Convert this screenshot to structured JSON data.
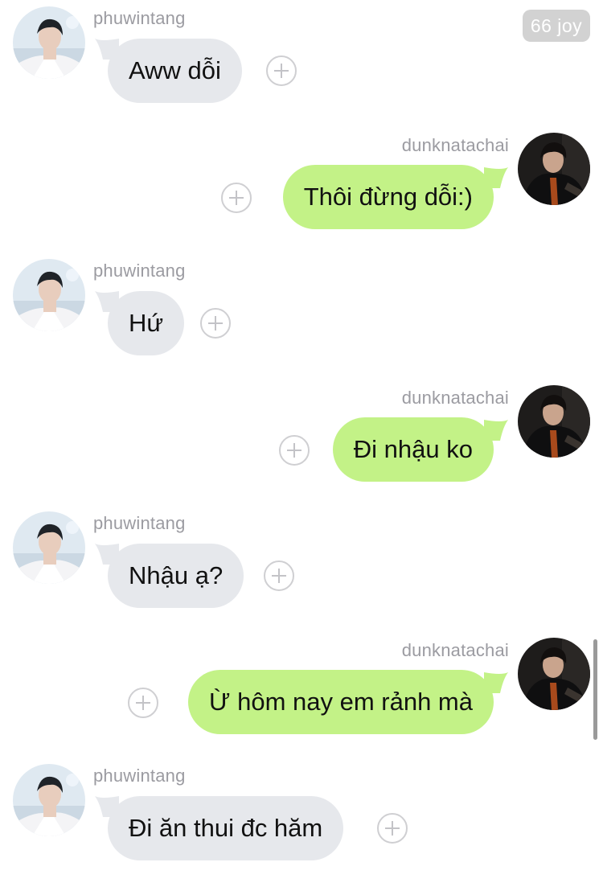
{
  "header": {
    "badge": "66 joy"
  },
  "messages": [
    {
      "sender": "phuwintang",
      "text": "Aww dỗi",
      "side": "incoming"
    },
    {
      "sender": "dunknatachai",
      "text": "Thôi đừng dỗi:)",
      "side": "outgoing"
    },
    {
      "sender": "phuwintang",
      "text": "Hứ",
      "side": "incoming"
    },
    {
      "sender": "dunknatachai",
      "text": "Đi nhậu ko",
      "side": "outgoing"
    },
    {
      "sender": "phuwintang",
      "text": "Nhậu ạ?",
      "side": "incoming"
    },
    {
      "sender": "dunknatachai",
      "text": "Ừ hôm nay em rảnh mà",
      "side": "outgoing"
    },
    {
      "sender": "phuwintang",
      "text": "Đi ăn thui đc hăm",
      "side": "incoming"
    }
  ],
  "colors": {
    "incoming_bubble": "#e6e8ec",
    "outgoing_bubble": "#c3f287",
    "sender_text": "#9b9ba1",
    "badge_bg": "#d2d2d2"
  }
}
